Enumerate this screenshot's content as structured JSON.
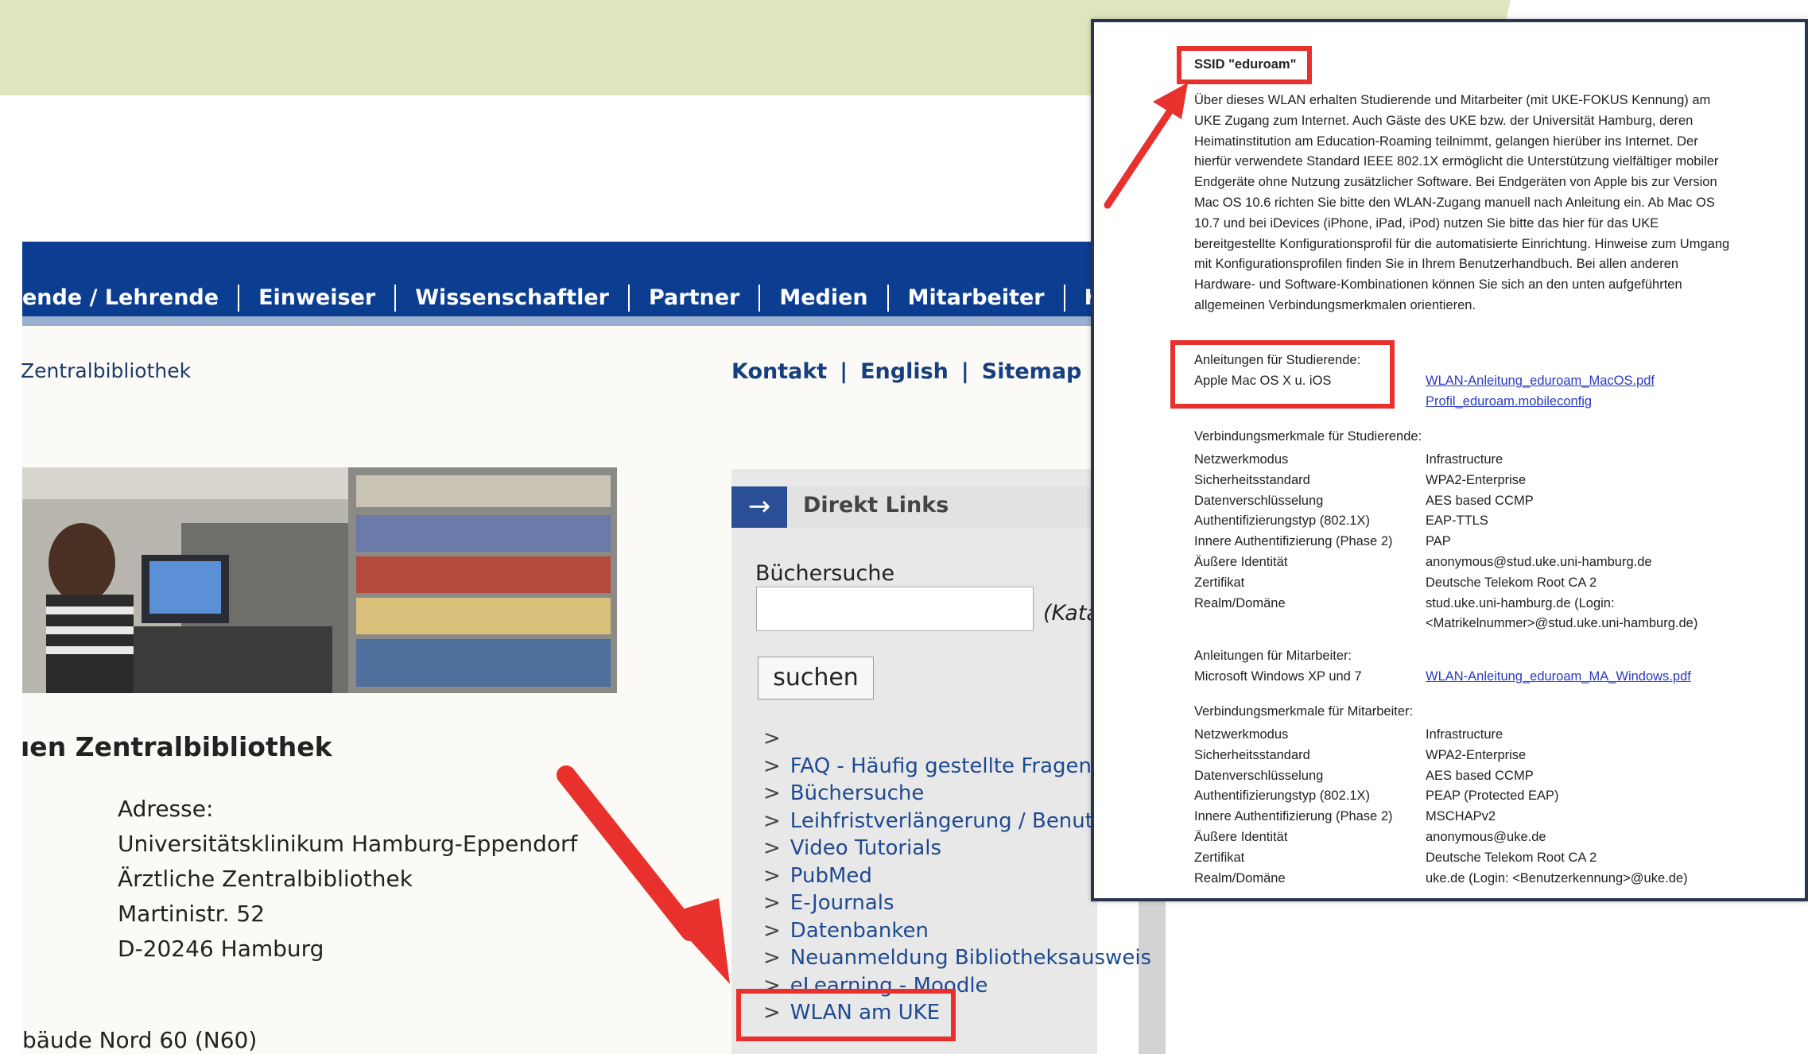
{
  "nav": {
    "items": [
      "ende / Lehrende",
      "Einweiser",
      "Wissenschaftler",
      "Partner",
      "Medien",
      "Mitarbeiter",
      "Karriere"
    ]
  },
  "breadcrumb": "Zentralbibliothek",
  "topnav": {
    "contact": "Kontakt",
    "english": "English",
    "sitemap": "Sitemap",
    "separator": "|"
  },
  "section_title": "ıen Zentralbibliothek",
  "address": {
    "label": "Adresse:",
    "lines": [
      "Universitätsklinikum Hamburg-Eppendorf",
      "Ärztliche Zentralbibliothek",
      "Martinistr. 52",
      "D-20246 Hamburg"
    ]
  },
  "building": "bäude Nord 60 (N60)",
  "direkt_links": {
    "arrow": "→",
    "title": "Direkt Links",
    "search_label": "Büchersuche",
    "search_value": "",
    "search_hint": "(Kata",
    "search_button": "suchen",
    "link_prefix": ">",
    "links": [
      "",
      "FAQ - Häufig gestellte Fragen",
      "Büchersuche",
      "Leihfristverlängerung / Benutzerd",
      "Video Tutorials",
      "PubMed",
      "E-Journals",
      "Datenbanken",
      "Neuanmeldung Bibliotheksausweis",
      "eLearning - Moodle",
      "WLAN am UKE"
    ]
  },
  "popup": {
    "ssid_title": "SSID \"eduroam\"",
    "intro": "Über dieses WLAN erhalten Studierende und Mitarbeiter (mit UKE-FOKUS Kennung) am UKE Zugang zum Internet. Auch Gäste des UKE bzw. der Universität Hamburg, deren Heimatinstitution am Education-Roaming teilnimmt, gelangen hierüber ins Internet. Der hierfür verwendete Standard IEEE 802.1X ermöglicht die Unterstützung vielfältiger mobiler Endgeräte ohne Nutzung zusätzlicher Software. Bei Endgeräten von Apple bis zur Version Mac OS 10.6 richten Sie bitte den WLAN-Zugang manuell nach Anleitung ein. Ab Mac OS 10.7 und bei iDevices (iPhone, iPad, iPod) nutzen Sie bitte das hier für das UKE bereitgestellte Konfigurationsprofil für die automatisierte Einrichtung. Hinweise zum Umgang mit Konfigurationsprofilen finden Sie in Ihrem Benutzerhandbuch. Bei allen anderen Hardware- und Software-Kombinationen können Sie sich an den unten aufgeführten allgemeinen Verbindungsmerkmalen orientieren.",
    "students_guides_title": "Anleitungen für Studierende:",
    "students_guides_os": "Apple Mac OS X u. iOS",
    "students_link1": "WLAN-Anleitung_eduroam_MacOS.pdf",
    "students_link2": "Profil_eduroam.mobileconfig",
    "students_props_title": "Verbindungsmerkmale für Studierende:",
    "students_props": [
      {
        "k": "Netzwerkmodus",
        "v": "Infrastructure"
      },
      {
        "k": "Sicherheitsstandard",
        "v": "WPA2-Enterprise"
      },
      {
        "k": "Datenverschlüsselung",
        "v": "AES based CCMP"
      },
      {
        "k": "Authentifizierungstyp (802.1X)",
        "v": "EAP-TTLS"
      },
      {
        "k": "Innere Authentifizierung (Phase 2)",
        "v": "PAP"
      },
      {
        "k": "Äußere Identität",
        "v": "anonymous@stud.uke.uni-hamburg.de"
      },
      {
        "k": "Zertifikat",
        "v": "Deutsche Telekom Root CA 2"
      },
      {
        "k": "Realm/Domäne",
        "v": "stud.uke.uni-hamburg.de (Login:"
      }
    ],
    "students_realm_cont": "<Matrikelnummer>@stud.uke.uni-hamburg.de)",
    "staff_guides_title": "Anleitungen für Mitarbeiter:",
    "staff_guides_os": "Microsoft Windows XP und 7",
    "staff_link": "WLAN-Anleitung_eduroam_MA_Windows.pdf",
    "staff_props_title": "Verbindungsmerkmale für Mitarbeiter:",
    "staff_props": [
      {
        "k": "Netzwerkmodus",
        "v": "Infrastructure"
      },
      {
        "k": "Sicherheitsstandard",
        "v": "WPA2-Enterprise"
      },
      {
        "k": "Datenverschlüsselung",
        "v": "AES based CCMP"
      },
      {
        "k": "Authentifizierungstyp (802.1X)",
        "v": "PEAP (Protected EAP)"
      },
      {
        "k": "Innere Authentifizierung (Phase 2)",
        "v": "MSCHAPv2"
      },
      {
        "k": "Äußere Identität",
        "v": "anonymous@uke.de"
      },
      {
        "k": "Zertifikat",
        "v": "Deutsche Telekom Root CA 2"
      },
      {
        "k": "Realm/Domäne",
        "v": "uke.de (Login: <Benutzerkennung>@uke.de)"
      }
    ]
  },
  "colors": {
    "nav": "#0b3d91",
    "accent_red": "#e8312d",
    "link": "#1e4a91",
    "green_band": "#dfe6bd"
  }
}
